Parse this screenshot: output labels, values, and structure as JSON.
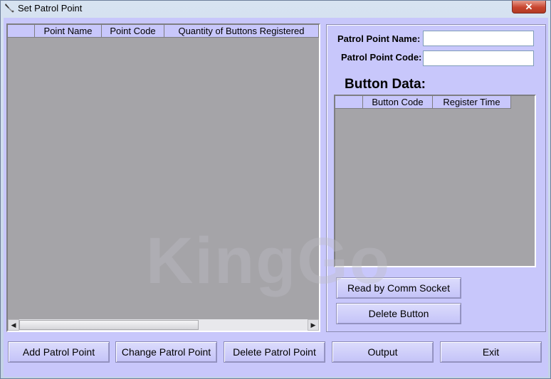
{
  "window": {
    "title": "Set Patrol Point",
    "close_label": "✕"
  },
  "main_grid": {
    "columns": [
      "",
      "Point Name",
      "Point Code",
      "Quantity of Buttons Registered"
    ]
  },
  "form": {
    "name_label": "Patrol Point Name:",
    "name_value": "",
    "code_label": "Patrol Point Code:",
    "code_value": ""
  },
  "button_data": {
    "title": "Button Data:",
    "columns": [
      "",
      "Button Code",
      "Register Time"
    ]
  },
  "panel_buttons": {
    "read_label": "Read by Comm Socket",
    "delete_label": "Delete Button"
  },
  "bottom_buttons": {
    "add_label": "Add Patrol Point",
    "change_label": "Change Patrol Point",
    "delete_label": "Delete Patrol Point",
    "output_label": "Output",
    "exit_label": "Exit"
  },
  "watermark": "KingGo",
  "colors": {
    "client_bg": "#c8c7fb",
    "grid_bg": "#a5a4a8"
  }
}
